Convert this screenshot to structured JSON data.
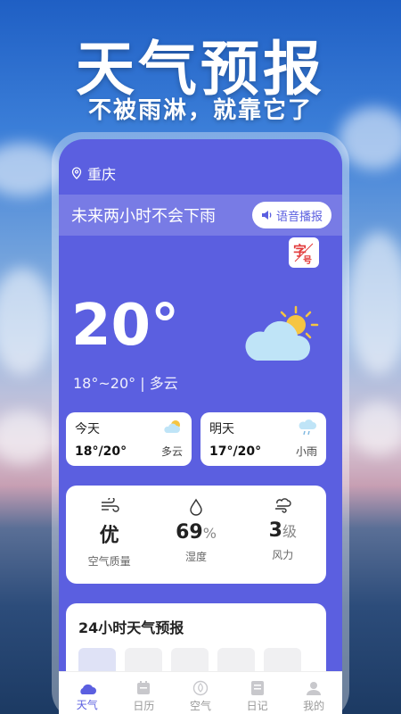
{
  "promo": {
    "headline": "天气预报",
    "subline": "不被雨淋，就靠它了"
  },
  "location": {
    "city": "重庆",
    "icon": "location-pin-icon"
  },
  "banner": {
    "text": "未来两小时不会下雨",
    "voice_button": "语音播报"
  },
  "font_badge": {
    "label": "字号",
    "icon": "font-size-icon"
  },
  "current": {
    "temperature": "20°",
    "range_condition": "18°~20° | 多云",
    "icon": "partly-cloudy-icon"
  },
  "days": [
    {
      "name": "今天",
      "range": "18°/20°",
      "condition": "多云",
      "icon": "partly-cloudy-icon"
    },
    {
      "name": "明天",
      "range": "17°/20°",
      "condition": "小雨",
      "icon": "light-rain-icon"
    }
  ],
  "air": {
    "quality": {
      "value": "优",
      "label": "空气质量",
      "icon": "air-wind-icon"
    },
    "humidity": {
      "value": "69",
      "unit": "%",
      "label": "湿度",
      "icon": "droplet-icon"
    },
    "wind": {
      "value": "3",
      "unit": "级",
      "label": "风力",
      "icon": "wind-icon"
    }
  },
  "forecast": {
    "title": "24小时天气预报"
  },
  "tabs": [
    {
      "label": "天气",
      "icon": "cloud-icon",
      "active": true
    },
    {
      "label": "日历",
      "icon": "calendar-icon",
      "active": false
    },
    {
      "label": "空气",
      "icon": "leaf-icon",
      "active": false
    },
    {
      "label": "日记",
      "icon": "notebook-icon",
      "active": false
    },
    {
      "label": "我的",
      "icon": "user-icon",
      "active": false
    }
  ],
  "colors": {
    "primary": "#5b5fe0",
    "card": "#ffffff",
    "sun": "#f5c542",
    "cloud": "#bfe4f7"
  }
}
